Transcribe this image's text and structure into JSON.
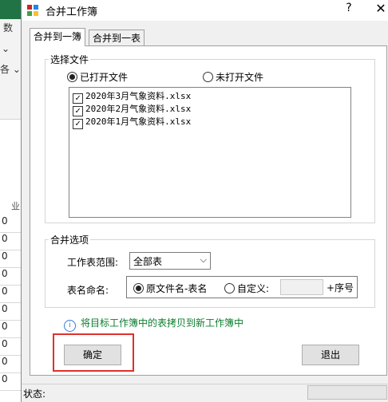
{
  "background": {
    "ribbon_fragments": [
      "数",
      "⌄",
      "各 ⌄"
    ],
    "rownums": [
      "0",
      "0",
      "0",
      "0",
      "0",
      "0",
      "0",
      "0",
      "0",
      "0"
    ],
    "col_fragment": "业"
  },
  "window": {
    "title": "合并工作簿",
    "help": "?",
    "close": "✕"
  },
  "tabs": [
    "合并到一簿",
    "合并到一表"
  ],
  "select_files": {
    "legend": "选择文件",
    "radio_open": "已打开文件",
    "radio_closed": "未打开文件",
    "files": [
      {
        "name": "2020年3月气象资料.xlsx",
        "checked": true
      },
      {
        "name": "2020年2月气象资料.xlsx",
        "checked": true
      },
      {
        "name": "2020年1月气象资料.xlsx",
        "checked": true
      }
    ]
  },
  "options": {
    "legend": "合并选项",
    "range_label": "工作表范围:",
    "range_value": "全部表",
    "naming_label": "表名命名:",
    "naming_radio_original": "原文件名-表名",
    "naming_radio_custom": "自定义:",
    "custom_value": "",
    "suffix_label": "+序号"
  },
  "info_text": "将目标工作簿中的表拷贝到新工作簿中",
  "buttons": {
    "ok": "确定",
    "exit": "退出"
  },
  "status": {
    "label": "状态:"
  },
  "colors": {
    "info_text": "#0a7d2c",
    "highlight": "#e0302b"
  }
}
